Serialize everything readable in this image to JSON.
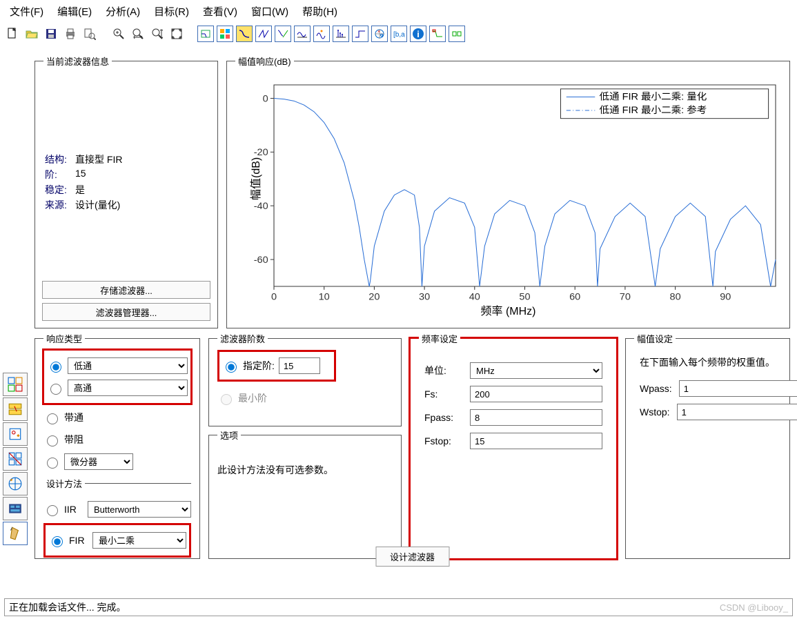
{
  "menu": {
    "file": "文件(F)",
    "edit": "编辑(E)",
    "analyze": "分析(A)",
    "target": "目标(R)",
    "view": "查看(V)",
    "window": "窗口(W)",
    "help": "帮助(H)"
  },
  "info": {
    "title": "当前滤波器信息",
    "rows": {
      "structure_k": "结构:",
      "structure_v": "直接型 FIR",
      "order_k": "阶:",
      "order_v": "15",
      "stable_k": "稳定:",
      "stable_v": "是",
      "source_k": "来源:",
      "source_v": "设计(量化)"
    },
    "store_btn": "存储滤波器...",
    "mgr_btn": "滤波器管理器..."
  },
  "mag": {
    "title": "幅值响应(dB)",
    "ylabel": "幅值(dB)",
    "xlabel": "频率 (MHz)",
    "legend1": "低通 FIR 最小二乘: 量化",
    "legend2": "低通 FIR 最小二乘: 参考"
  },
  "resp": {
    "title": "响应类型",
    "lowpass": "低通",
    "highpass": "高通",
    "bandpass": "带通",
    "bandstop": "带阻",
    "diff": "微分器",
    "method_title": "设计方法",
    "iir": "IIR",
    "iir_sel": "Butterworth",
    "fir": "FIR",
    "fir_sel": "最小二乘"
  },
  "order": {
    "title": "滤波器阶数",
    "specify": "指定阶:",
    "specify_val": "15",
    "min": "最小阶"
  },
  "opts": {
    "title": "选项",
    "text": "此设计方法没有可选参数。"
  },
  "freq": {
    "title": "频率设定",
    "unit_lbl": "单位:",
    "unit": "MHz",
    "fs_lbl": "Fs:",
    "fs": "200",
    "fpass_lbl": "Fpass:",
    "fpass": "8",
    "fstop_lbl": "Fstop:",
    "fstop": "15"
  },
  "magset": {
    "title": "幅值设定",
    "hint": "在下面输入每个频带的权重值。",
    "wpass_lbl": "Wpass:",
    "wpass": "1",
    "wstop_lbl": "Wstop:",
    "wstop": "1"
  },
  "design_btn": "设计滤波器",
  "status": "正在加载会话文件... 完成。",
  "watermark": "CSDN @Libooy_",
  "chart_data": {
    "type": "line",
    "title": "幅值响应(dB)",
    "xlabel": "频率 (MHz)",
    "ylabel": "幅值(dB)",
    "xlim": [
      0,
      100
    ],
    "ylim": [
      -70,
      5
    ],
    "xticks": [
      0,
      10,
      20,
      30,
      40,
      50,
      60,
      70,
      80,
      90
    ],
    "yticks": [
      0,
      -20,
      -40,
      -60
    ],
    "legend": [
      "低通 FIR 最小二乘: 量化",
      "低通 FIR 最小二乘: 参考"
    ],
    "notches_x": [
      19,
      29.5,
      41,
      53,
      64.5,
      76,
      87.5,
      99
    ],
    "lobe_peaks_db": [
      -33,
      -37,
      -37,
      -37,
      -38,
      -38,
      -40,
      -40
    ],
    "series": [
      {
        "name": "response",
        "x": [
          0,
          2,
          4,
          6,
          8,
          10,
          12,
          14,
          16,
          17,
          18,
          18.8,
          19,
          19.2,
          20,
          22,
          24,
          26,
          28,
          29,
          29.5,
          30,
          32,
          35,
          38,
          40,
          41,
          42,
          44,
          47,
          50,
          52,
          53,
          54,
          56,
          59,
          62,
          64,
          64.5,
          65,
          68,
          71,
          74,
          76,
          77,
          80,
          83,
          86,
          87.5,
          88,
          91,
          94,
          97,
          99,
          100
        ],
        "y": [
          0,
          -0.3,
          -1,
          -2.5,
          -5,
          -9,
          -15,
          -24,
          -38,
          -48,
          -60,
          -68,
          -70,
          -68,
          -55,
          -42,
          -36,
          -34,
          -36,
          -48,
          -70,
          -55,
          -42,
          -37,
          -39,
          -48,
          -70,
          -55,
          -43,
          -38,
          -40,
          -50,
          -70,
          -55,
          -43,
          -38,
          -40,
          -50,
          -70,
          -56,
          -44,
          -39,
          -44,
          -70,
          -56,
          -44,
          -39,
          -44,
          -70,
          -57,
          -45,
          -40,
          -47,
          -70,
          -60
        ]
      }
    ]
  }
}
